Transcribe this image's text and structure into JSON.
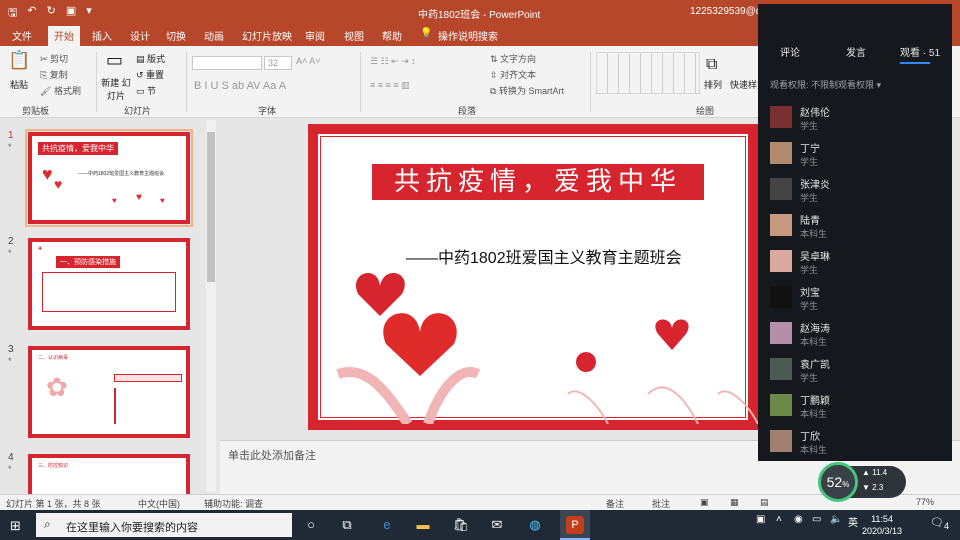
{
  "titlebar": {
    "doc_title": "中药1802班会 - PowerPoint",
    "user": "1225329539@q"
  },
  "ribbon_tabs": [
    "文件",
    "开始",
    "插入",
    "设计",
    "切换",
    "动画",
    "幻灯片放映",
    "审阅",
    "视图",
    "帮助",
    "操作说明搜索"
  ],
  "ribbon": {
    "clipboard": {
      "paste": "粘贴",
      "cut": "剪切",
      "copy": "复制",
      "format_painter": "格式刷",
      "label": "剪贴板"
    },
    "slides": {
      "new_slide": "新建\n幻灯片",
      "layout": "版式",
      "reset": "重置",
      "section": "节",
      "label": "幻灯片"
    },
    "font": {
      "size": "32",
      "label": "字体"
    },
    "paragraph": {
      "text_direction": "文字方向",
      "align_text": "对齐文本",
      "smartart": "转换为 SmartArt",
      "label": "段落"
    },
    "drawing": {
      "arrange": "排列",
      "quick_styles": "快速样式",
      "label": "绘图"
    }
  },
  "slides": [
    {
      "number": "1",
      "title": "共抗疫情，爱我中华",
      "subtitle": "——中药1802班爱国主义教育主题班会"
    },
    {
      "number": "2",
      "title": "一、预防感染措施",
      "header": "一、预防感染措施"
    },
    {
      "number": "3",
      "header": "二、认识病毒"
    },
    {
      "number": "4",
      "header": "三、防控知识"
    }
  ],
  "main_slide": {
    "title": "共抗疫情，爱我中华",
    "subtitle": "——中药1802班爱国主义教育主题班会"
  },
  "notes_placeholder": "单击此处添加备注",
  "statusbar": {
    "slide_info": "幻灯片 第 1 张，共 8 张",
    "language": "中文(中国)",
    "accessibility": "辅助功能: 调查",
    "notes": "备注",
    "comments": "批注",
    "zoom": "77%"
  },
  "viewer": {
    "tabs": [
      "评论",
      "发言",
      "观看 · 51"
    ],
    "filter": "观看权限: 不限制观看权限 ▾",
    "people": [
      {
        "name": "赵伟伦",
        "role": "学生"
      },
      {
        "name": "丁宁",
        "role": "学生"
      },
      {
        "name": "张津炎",
        "role": "学生"
      },
      {
        "name": "陆青",
        "role": "本科生"
      },
      {
        "name": "吴卓琳",
        "role": "学生"
      },
      {
        "name": "刘宝",
        "role": "学生"
      },
      {
        "name": "赵海涛",
        "role": "本科生"
      },
      {
        "name": "袁广凯",
        "role": "学生"
      },
      {
        "name": "丁鹏颖",
        "role": "本科生"
      },
      {
        "name": "丁欣",
        "role": "本科生"
      }
    ]
  },
  "network": {
    "percent": "52",
    "up": "11.4",
    "down": "2.3",
    "unit": "K/s"
  },
  "taskbar": {
    "search_placeholder": "在这里输入你要搜索的内容",
    "time": "11:54",
    "date": "2020/3/13",
    "notifications": "4"
  },
  "colors": {
    "accent": "#b7472a",
    "slide_red": "#d7252f",
    "viewer_bg": "#15181d"
  }
}
